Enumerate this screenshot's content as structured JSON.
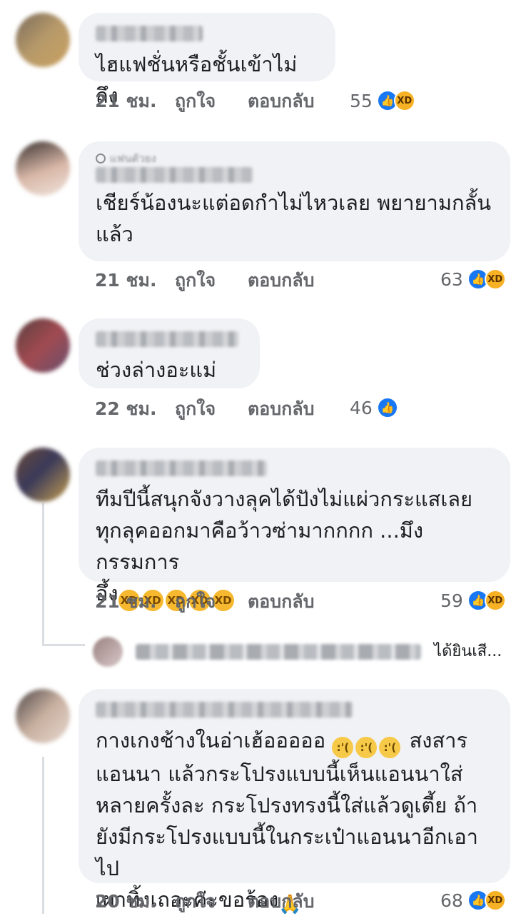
{
  "comments": [
    {
      "text": "ไฮแฟชั่นหรือชั้นเข้าไม่ถึง",
      "time": "21 ชม.",
      "like": "ถูกใจ",
      "reply": "ตอบกลับ",
      "count": "55",
      "reactions": [
        "like-icon",
        "haha-icon"
      ]
    },
    {
      "badge": "แฟนตัวยง",
      "text": "เชียร์น้องนะแต่อดกำไม่ไหวเลย พยายามกลั้น\nแล้ว",
      "time": "21 ชม.",
      "like": "ถูกใจ",
      "reply": "ตอบกลับ",
      "count": "63",
      "reactions": [
        "like-icon",
        "haha-icon"
      ]
    },
    {
      "text": "ช่วงล่างอะแม่",
      "time": "22 ชม.",
      "like": "ถูกใจ",
      "reply": "ตอบกลับ",
      "count": "46",
      "reactions": [
        "like-icon"
      ]
    },
    {
      "text": "ทีมปีนี้สนุกจังวางลุคได้ปังไม่แผ่วกระแสเลย\nทุกลุคออกมาคือว้าวซ่ามากกกก ...มึงกรรมการ\nอึ้ง",
      "emoji_after": [
        "rofl",
        "rofl",
        "rofl",
        "rofl",
        "rofl"
      ],
      "time": "21 ชม.",
      "like": "ถูกใจ",
      "reply": "ตอบกลับ",
      "count": "59",
      "reactions": [
        "like-icon",
        "haha-icon"
      ]
    },
    {
      "text": "กางเกงช้างในอ่าเฮ้อออออ",
      "emoji_mid": [
        "sad-tear",
        "sad-tear",
        "sad-tear"
      ],
      "text2": " สงสาร\nแอนนา แล้วกระโปรงแบบนี้เห็นแอนนาใส่\nหลายครั้งละ กระโปรงทรงนี้ใส่แล้วดูเตี้ย ถ้า\nยังมีกระโปรงแบบนี้ในกระเป๋าแอนนาอีกเอาไป\nเผาทิ้งเถอะค่ะขอร้อง",
      "emoji_end": "folded-hands",
      "time": "20 ชม.",
      "like": "ถูกใจ",
      "reply": "ตอบกลับ",
      "count": "68",
      "reactions": [
        "like-icon",
        "haha-icon"
      ]
    }
  ],
  "reply_preview": {
    "text": "ได้ยินเสี..."
  }
}
